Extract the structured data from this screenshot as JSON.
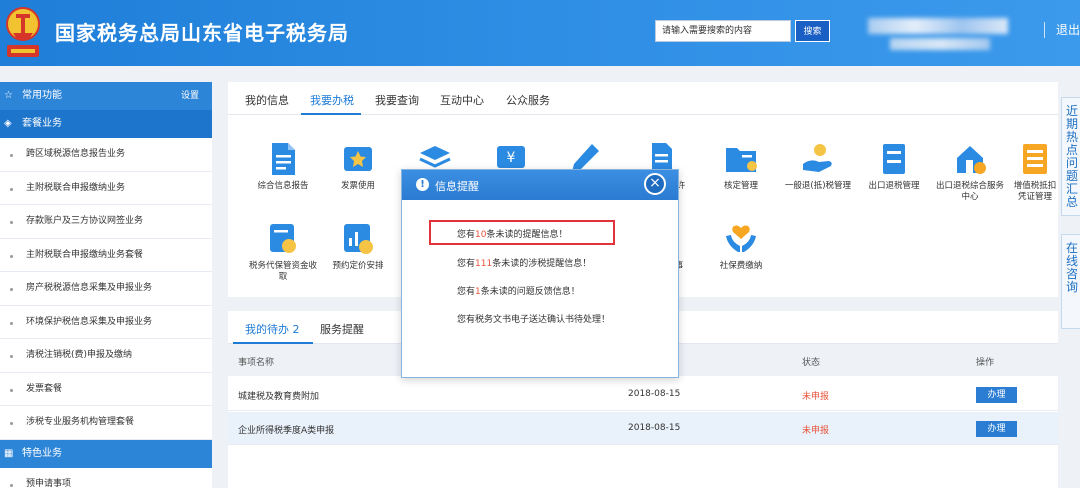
{
  "header": {
    "title": "国家税务总局山东省电子税务局",
    "search_placeholder": "请输入需要搜索的内容",
    "search_button": "搜索",
    "logout": "退出"
  },
  "sidebar": {
    "common": {
      "label": "常用功能",
      "settings": "设置"
    },
    "package": {
      "label": "套餐业务"
    },
    "items": [
      "跨区域税源信息报告业务",
      "主附税联合申报缴纳业务",
      "存款账户及三方协议网签业务",
      "主附税联合申报缴纳业务套餐",
      "房产税税源信息采集及申报业务",
      "环境保护税信息采集及申报业务",
      "清税注销税(费)申报及缴纳",
      "发票套餐",
      "涉税专业服务机构管理套餐"
    ],
    "special": {
      "label": "特色业务"
    },
    "special_items": [
      "预申请事项"
    ]
  },
  "top_tabs": [
    "我的信息",
    "我要办税",
    "我要查询",
    "互动中心",
    "公众服务"
  ],
  "functions": [
    {
      "label": "综合信息报告",
      "icon": "doc-icon"
    },
    {
      "label": "发票使用",
      "icon": "invoice-icon"
    },
    {
      "label": "",
      "icon": "layers-icon"
    },
    {
      "label": "",
      "icon": "yen-ticket-icon"
    },
    {
      "label": "",
      "icon": "pen-icon"
    },
    {
      "label": "许",
      "icon": "license-icon"
    },
    {
      "label": "核定管理",
      "icon": "folder-icon"
    },
    {
      "label": "一般退(抵)税管理",
      "icon": "refund-hand-icon"
    },
    {
      "label": "出口退税管理",
      "icon": "cabinet-icon"
    },
    {
      "label": "出口退税综合服务中心",
      "icon": "house-gear-icon"
    },
    {
      "label": "增值税抵扣凭证管理",
      "icon": "ledger-icon"
    },
    {
      "label": "税务代保管资金收取",
      "icon": "fund-icon"
    },
    {
      "label": "预约定价安排",
      "icon": "chart-yen-icon"
    },
    {
      "label": "事",
      "icon": "misc-icon"
    },
    {
      "label": "社保费缴纳",
      "icon": "hands-heart-icon"
    }
  ],
  "right_float": {
    "top": "近期热点问题汇总",
    "bottom": "在线咨询"
  },
  "modal": {
    "title": "信息提醒",
    "messages": [
      {
        "pre": "您有",
        "num": "10",
        "post": "条未读的提醒信息！"
      },
      {
        "pre": "您有",
        "num": "111",
        "post": "条未读的涉税提醒信息！"
      },
      {
        "pre": "您有",
        "num": "1",
        "post": "条未读的问题反馈信息！"
      },
      {
        "pre": "您有税务文书电子送达确认书待处理！",
        "num": "",
        "post": ""
      }
    ]
  },
  "todo": {
    "tab_active": "我的待办",
    "tab_active_count": "2",
    "tab_other": "服务提醒",
    "columns": {
      "name": "事项名称",
      "status": "状态",
      "op": "操作"
    },
    "rows": [
      {
        "name": "城建税及教育费附加",
        "date": "2018-08-15",
        "status": "未申报",
        "op": "办理"
      },
      {
        "name": "企业所得税季度A类申报",
        "date": "2018-08-15",
        "status": "未申报",
        "op": "办理"
      }
    ]
  },
  "colors": {
    "primary": "#2d85d8",
    "status_red": "#e8533a",
    "highlight_border": "#e2333a"
  }
}
